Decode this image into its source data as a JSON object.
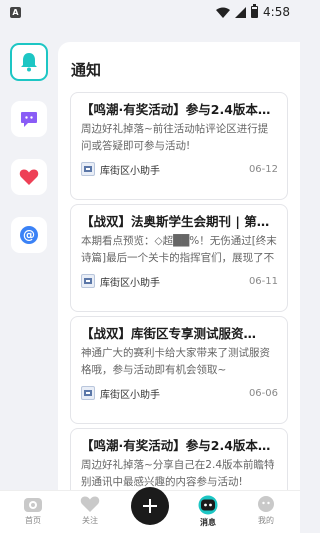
{
  "status_bar": {
    "sim_label": "A",
    "time": "4:58"
  },
  "sidebar": {
    "items": [
      {
        "icon": "bell-icon",
        "active": true
      },
      {
        "icon": "chat-icon",
        "active": false
      },
      {
        "icon": "heart-icon",
        "active": false
      },
      {
        "icon": "at-icon",
        "active": false
      }
    ]
  },
  "main": {
    "title": "通知",
    "cards": [
      {
        "title": "【鸣潮·有奖活动】参与2.4版本…",
        "body": "周边好礼掉落~前往活动帖评论区进行提问或答疑即可参与活动!",
        "author": "库街区小助手",
        "date": "06-12"
      },
      {
        "title": "【战双】法奥斯学生会期刊 | 第…",
        "body": "本期看点预览：◇超██%！无伤通过[终末诗篇]最后一个关卡的指挥官们，展现了不可思议…",
        "author": "库街区小助手",
        "date": "06-11"
      },
      {
        "title": "【战双】库街区专享测试服资…",
        "body": "神通广大的赛利卡给大家带来了测试服资格哦，参与活动即有机会领取~",
        "author": "库街区小助手",
        "date": "06-06"
      },
      {
        "title": "【鸣潮·有奖活动】参与2.4版本…",
        "body": "周边好礼掉落~分享自己在2.4版本前瞻特别通讯中最感兴趣的内容参与活动!",
        "author": "",
        "date": ""
      }
    ]
  },
  "bottom_nav": {
    "items": [
      {
        "label": "首页",
        "icon": "home-icon",
        "active": false
      },
      {
        "label": "关注",
        "icon": "heart-icon",
        "active": false
      },
      {
        "label": "消息",
        "icon": "message-icon",
        "active": true
      },
      {
        "label": "我的",
        "icon": "profile-icon",
        "active": false
      }
    ],
    "fab_icon": "plus-icon"
  },
  "colors": {
    "accent": "#1dc6c4",
    "chat": "#8a5cf6",
    "heart": "#ee4056",
    "at": "#3b82f6",
    "fab": "#1b1b1b"
  }
}
